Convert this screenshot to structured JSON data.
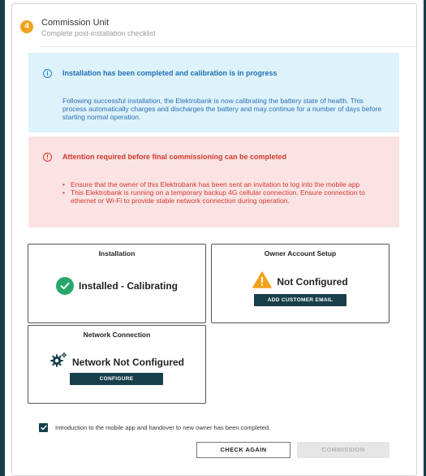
{
  "step": {
    "number": "4",
    "title": "Commission Unit",
    "subtitle": "Complete post-installation checklist"
  },
  "info_banner": {
    "icon": "info-icon",
    "title": "Installation has been completed and calibration is in progress",
    "body": "Following successful installation, the Elektrobank is now calibrating the battery state of health. This process automatically charges and discharges the battery and may continue for a number of days before starting normal operation."
  },
  "warning_banner": {
    "icon": "alert-icon",
    "title": "Attention required before final commissioning can be completed",
    "items": [
      "Ensure that the owner of this Elektrobank has been sent an invitation to log into the mobile app",
      "This Elektrobank is running on a temporary backup 4G cellular connection. Ensure connection to ethernet or Wi-Fi to provide stable network connection during operation."
    ]
  },
  "cards": {
    "installation": {
      "title": "Installation",
      "status": "Installed - Calibrating",
      "icon": "check-circle-icon"
    },
    "owner": {
      "title": "Owner Account Setup",
      "status": "Not Configured",
      "icon": "warning-triangle-icon",
      "button": "ADD CUSTOMER EMAIL"
    },
    "network": {
      "title": "Network Connection",
      "status": "Network Not Configured",
      "icon": "gear-settings-icon",
      "button": "CONFIGURE"
    }
  },
  "confirmation": {
    "checked": true,
    "text": "Introduction to the mobile app and handover to new owner has been completed."
  },
  "actions": {
    "check_again": "CHECK AGAIN",
    "commission": "COMMISSION"
  },
  "colors": {
    "accent": "#163f4a",
    "step_badge": "#f2a11c",
    "info_bg": "#def2fb",
    "info_text": "#1f6fb2",
    "warn_bg": "#fbe3e3",
    "warn_text": "#d13a2f",
    "success": "#27a86a",
    "warning": "#f2a11c"
  }
}
